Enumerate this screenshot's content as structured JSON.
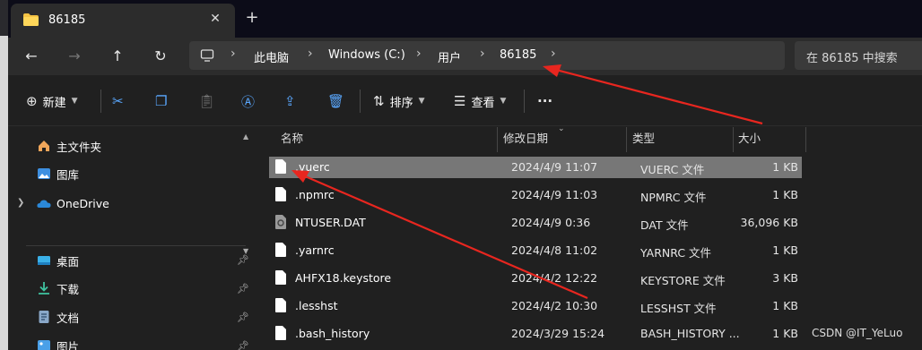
{
  "tab": {
    "title": "86185",
    "close_glyph": "✕",
    "new_glyph": "+"
  },
  "nav": {
    "back": "←",
    "forward": "→",
    "up": "↑",
    "refresh": "↻"
  },
  "breadcrumb": [
    "此电脑",
    "Windows (C:)",
    "用户",
    "86185"
  ],
  "search": {
    "placeholder": "在 86185 中搜索"
  },
  "toolbar": {
    "new_label": "新建",
    "sort_label": "排序",
    "view_label": "查看",
    "more": "···"
  },
  "sidebar": {
    "items": [
      {
        "label": "主文件夹",
        "icon": "home-icon"
      },
      {
        "label": "图库",
        "icon": "gallery-icon"
      },
      {
        "label": "OneDrive",
        "icon": "onedrive-icon"
      },
      {
        "label": "桌面",
        "icon": "desktop-icon",
        "pinned": true
      },
      {
        "label": "下载",
        "icon": "download-icon",
        "pinned": true
      },
      {
        "label": "文档",
        "icon": "documents-icon",
        "pinned": true
      },
      {
        "label": "图片",
        "icon": "pictures-icon",
        "pinned": true
      }
    ]
  },
  "columns": {
    "name": "名称",
    "date": "修改日期",
    "type": "类型",
    "size": "大小"
  },
  "files": [
    {
      "name": ".vuerc",
      "date": "2024/4/9 11:07",
      "type": "VUERC 文件",
      "size": "1 KB",
      "selected": true
    },
    {
      "name": ".npmrc",
      "date": "2024/4/9 11:03",
      "type": "NPMRC 文件",
      "size": "1 KB"
    },
    {
      "name": "NTUSER.DAT",
      "date": "2024/4/9 0:36",
      "type": "DAT 文件",
      "size": "36,096 KB"
    },
    {
      "name": ".yarnrc",
      "date": "2024/4/8 11:02",
      "type": "YARNRC 文件",
      "size": "1 KB"
    },
    {
      "name": "AHFX18.keystore",
      "date": "2024/4/2 12:22",
      "type": "KEYSTORE 文件",
      "size": "3 KB"
    },
    {
      "name": ".lesshst",
      "date": "2024/4/2 10:30",
      "type": "LESSHST 文件",
      "size": "1 KB"
    },
    {
      "name": ".bash_history",
      "date": "2024/3/29 15:24",
      "type": "BASH_HISTORY ...",
      "size": "1 KB"
    }
  ],
  "watermark": "CSDN @IT_YeLuo",
  "colors": {
    "accent": "#5aa8ff",
    "selection": "#777777",
    "annotation_arrow": "#e8261f",
    "folder": "#f5c344"
  }
}
